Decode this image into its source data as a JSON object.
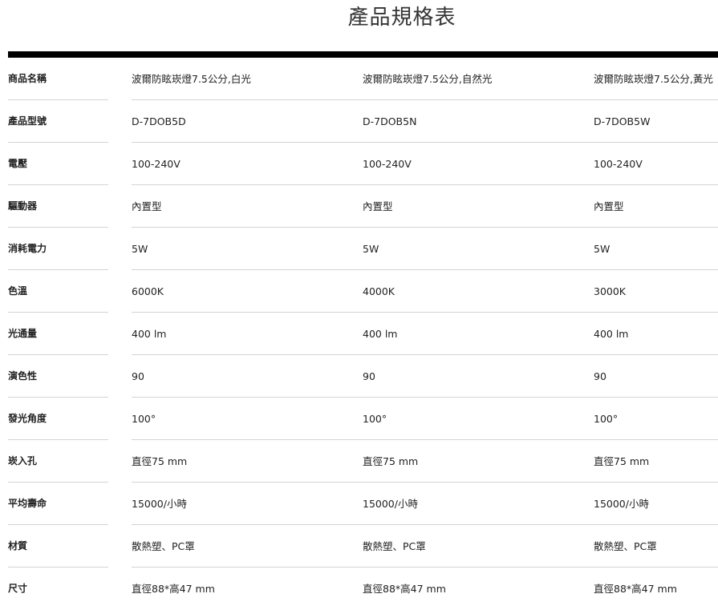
{
  "page": {
    "title": "產品規格表"
  },
  "spec_table": {
    "rows": [
      {
        "label": "商品名稱",
        "values": [
          "波爾防眩崁燈7.5公分,白光",
          "波爾防眩崁燈7.5公分,自然光",
          "波爾防眩崁燈7.5公分,黃光"
        ]
      },
      {
        "label": "產品型號",
        "values": [
          "D-7DOB5D",
          "D-7DOB5N",
          "D-7DOB5W"
        ]
      },
      {
        "label": "電壓",
        "values": [
          "100-240V",
          "100-240V",
          "100-240V"
        ]
      },
      {
        "label": "驅動器",
        "values": [
          "內置型",
          "內置型",
          "內置型"
        ]
      },
      {
        "label": "消耗電力",
        "values": [
          "5W",
          "5W",
          "5W"
        ]
      },
      {
        "label": "色溫",
        "values": [
          "6000K",
          "4000K",
          "3000K"
        ]
      },
      {
        "label": "光通量",
        "values": [
          "400 lm",
          "400 lm",
          "400 lm"
        ]
      },
      {
        "label": "演色性",
        "values": [
          "90",
          "90",
          "90"
        ]
      },
      {
        "label": "發光角度",
        "values": [
          "100°",
          "100°",
          "100°"
        ]
      },
      {
        "label": "崁入孔",
        "values": [
          "直徑75 mm",
          "直徑75 mm",
          "直徑75 mm"
        ]
      },
      {
        "label": "平均壽命",
        "values": [
          "15000/小時",
          "15000/小時",
          "15000/小時"
        ]
      },
      {
        "label": "材質",
        "values": [
          "散熱塑、PC罩",
          "散熱塑、PC罩",
          "散熱塑、PC罩"
        ]
      },
      {
        "label": "尺寸",
        "values": [
          "直徑88*高47 mm",
          "直徑88*高47 mm",
          "直徑88*高47 mm"
        ]
      }
    ]
  }
}
